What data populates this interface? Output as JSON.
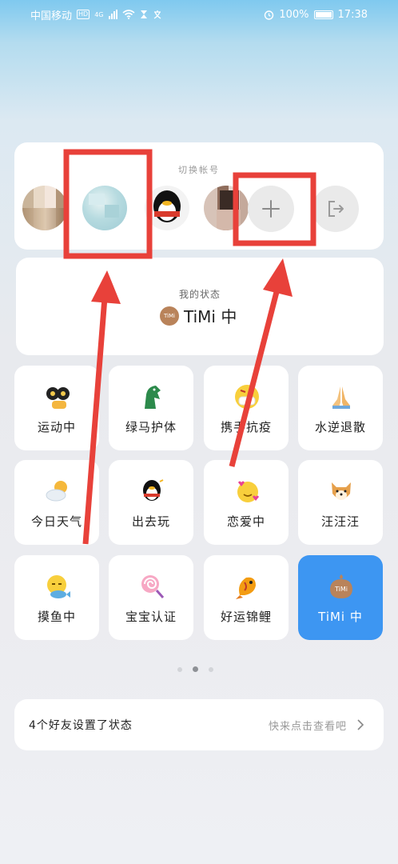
{
  "status_bar": {
    "carrier": "中国移动",
    "hd_badge": "HD",
    "network": "4G",
    "battery_text": "100%",
    "time": "17:38"
  },
  "account_switch": {
    "title": "切换帐号",
    "avatars": [
      "avatar-1",
      "avatar-2",
      "avatar-3",
      "avatar-4"
    ],
    "add_icon": "plus-icon",
    "logout_icon": "logout-icon"
  },
  "my_status": {
    "title": "我的状态",
    "value": "TiMi 中",
    "badge_text": "TiMi"
  },
  "status_options": [
    {
      "label": "运动中",
      "icon": "sport-icon"
    },
    {
      "label": "绿马护体",
      "icon": "green-horse-icon"
    },
    {
      "label": "携手抗疫",
      "icon": "mask-icon"
    },
    {
      "label": "水逆退散",
      "icon": "praying-hands-icon"
    },
    {
      "label": "今日天气",
      "icon": "weather-icon"
    },
    {
      "label": "出去玩",
      "icon": "penguin-icon"
    },
    {
      "label": "恋爱中",
      "icon": "in-love-icon"
    },
    {
      "label": "汪汪汪",
      "icon": "dog-icon"
    },
    {
      "label": "摸鱼中",
      "icon": "fish-face-icon"
    },
    {
      "label": "宝宝认证",
      "icon": "lollipop-icon"
    },
    {
      "label": "好运锦鲤",
      "icon": "koi-icon"
    },
    {
      "label": "TiMi 中",
      "icon": "timi-icon",
      "selected": true
    }
  ],
  "pagination": {
    "total": 3,
    "current": 2
  },
  "friends": {
    "text": "4个好友设置了状态",
    "link": "快来点击查看吧"
  },
  "colors": {
    "accent_blue": "#3d96f2",
    "annotation_red": "#e8413a"
  }
}
